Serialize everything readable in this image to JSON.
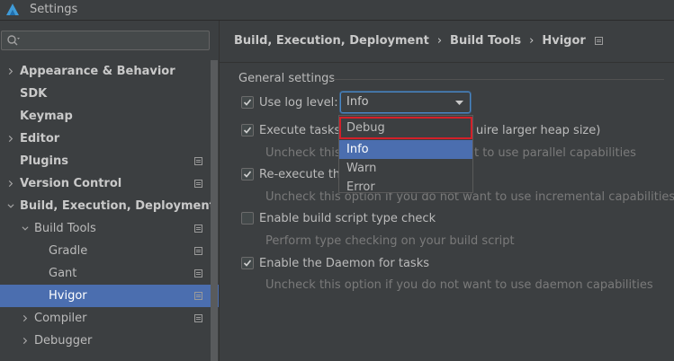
{
  "window": {
    "title": "Settings",
    "app_icon": "app-logo-icon"
  },
  "search": {
    "placeholder": "",
    "value": ""
  },
  "sidebar": {
    "items": [
      {
        "label": "Appearance & Behavior",
        "level": 0,
        "expandable": true,
        "expanded": false,
        "bold": true,
        "project": false
      },
      {
        "label": "SDK",
        "level": 0,
        "expandable": false,
        "bold": true,
        "project": false
      },
      {
        "label": "Keymap",
        "level": 0,
        "expandable": false,
        "bold": true,
        "project": false
      },
      {
        "label": "Editor",
        "level": 0,
        "expandable": true,
        "expanded": false,
        "bold": true,
        "project": false
      },
      {
        "label": "Plugins",
        "level": 0,
        "expandable": false,
        "bold": true,
        "project": true
      },
      {
        "label": "Version Control",
        "level": 0,
        "expandable": true,
        "expanded": false,
        "bold": true,
        "project": true
      },
      {
        "label": "Build, Execution, Deployment",
        "level": 0,
        "expandable": true,
        "expanded": true,
        "bold": true,
        "project": false
      },
      {
        "label": "Build Tools",
        "level": 1,
        "expandable": true,
        "expanded": true,
        "bold": false,
        "project": true
      },
      {
        "label": "Gradle",
        "level": 2,
        "expandable": false,
        "bold": false,
        "project": true
      },
      {
        "label": "Gant",
        "level": 2,
        "expandable": false,
        "bold": false,
        "project": true
      },
      {
        "label": "Hvigor",
        "level": 2,
        "expandable": false,
        "bold": false,
        "project": true,
        "selected": true
      },
      {
        "label": "Compiler",
        "level": 1,
        "expandable": true,
        "expanded": false,
        "bold": false,
        "project": true
      },
      {
        "label": "Debugger",
        "level": 1,
        "expandable": true,
        "expanded": false,
        "bold": false,
        "project": false
      }
    ]
  },
  "breadcrumb": {
    "parts": [
      "Build, Execution, Deployment",
      "Build Tools",
      "Hvigor"
    ],
    "separator": "›"
  },
  "general": {
    "title": "General settings",
    "log_level": {
      "label": "Use log level:",
      "checked": true,
      "selected": "Info",
      "options": [
        "Debug",
        "Info",
        "Warn",
        "Error"
      ],
      "highlighted_index": 1,
      "boxed_index": 0
    },
    "parallel": {
      "label_left": "Execute tasks in",
      "label_right": "uire larger heap size)",
      "checked": true,
      "hint_left": "Uncheck this o",
      "hint_right": "t to use parallel capabilities"
    },
    "incremental": {
      "label": "Re-execute the",
      "checked": true,
      "hint": "Uncheck this option if you do not want to use incremental capabilities"
    },
    "type_check": {
      "label": "Enable build script type check",
      "checked": false,
      "hint": "Perform type checking on your build script"
    },
    "daemon": {
      "label": "Enable the Daemon for tasks",
      "checked": true,
      "hint": "Uncheck this option if you do not want to use daemon capabilities"
    }
  },
  "colors": {
    "background": "#3c3f41",
    "selection": "#4b6eaf",
    "focus_border": "#4a88c7",
    "annotation_red": "#d32029"
  }
}
